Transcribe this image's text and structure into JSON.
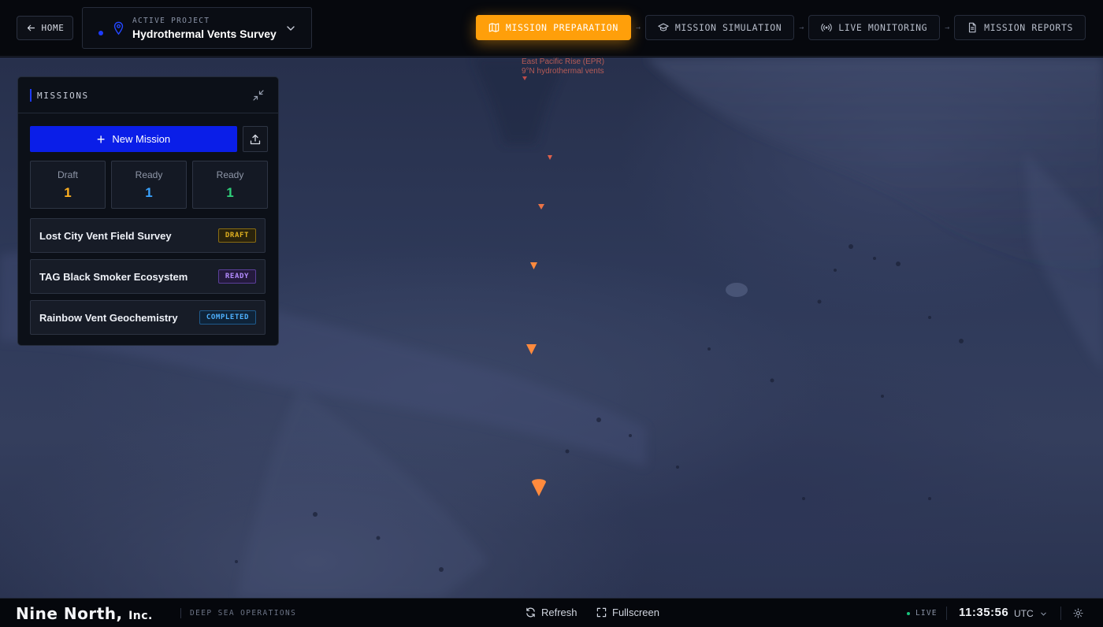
{
  "topbar": {
    "home_label": "HOME",
    "project_label": "ACTIVE PROJECT",
    "project_name": "Hydrothermal Vents Survey",
    "steps": [
      {
        "label": "MISSION PREPARATION",
        "icon": "map-icon",
        "active": true
      },
      {
        "label": "MISSION SIMULATION",
        "icon": "graduation-cap-icon",
        "active": false
      },
      {
        "label": "LIVE MONITORING",
        "icon": "broadcast-icon",
        "active": false
      },
      {
        "label": "MISSION REPORTS",
        "icon": "document-icon",
        "active": false
      }
    ],
    "step_arrow": "→"
  },
  "scene": {
    "marker_label_line1": "East Pacific Rise (EPR)",
    "marker_label_line2": "9°N hydrothermal vents",
    "marker_color": "#ff8a3d"
  },
  "missions_panel": {
    "title": "MISSIONS",
    "new_mission_label": "New Mission",
    "stats": [
      {
        "label": "Draft",
        "value": "1",
        "color": "#ffb020"
      },
      {
        "label": "Ready",
        "value": "1",
        "color": "#3aa3ff"
      },
      {
        "label": "Ready",
        "value": "1",
        "color": "#2fd07a"
      }
    ],
    "missions": [
      {
        "name": "Lost City Vent Field Survey",
        "status": "DRAFT",
        "badge_color": "#e0b020",
        "badge_bg": "#2a230c"
      },
      {
        "name": "TAG Black Smoker Ecosystem",
        "status": "READY",
        "badge_color": "#b48cff",
        "badge_bg": "#241a3d"
      },
      {
        "name": "Rainbow Vent Geochemistry",
        "status": "COMPLETED",
        "badge_color": "#4fb2ff",
        "badge_bg": "#0f2338"
      }
    ]
  },
  "footer": {
    "brand": "Nine North,",
    "brand_suffix": "Inc.",
    "tagline": "DEEP SEA OPERATIONS",
    "refresh_label": "Refresh",
    "fullscreen_label": "Fullscreen",
    "live_label": "LIVE",
    "time": "11:35:56",
    "timezone": "UTC"
  }
}
